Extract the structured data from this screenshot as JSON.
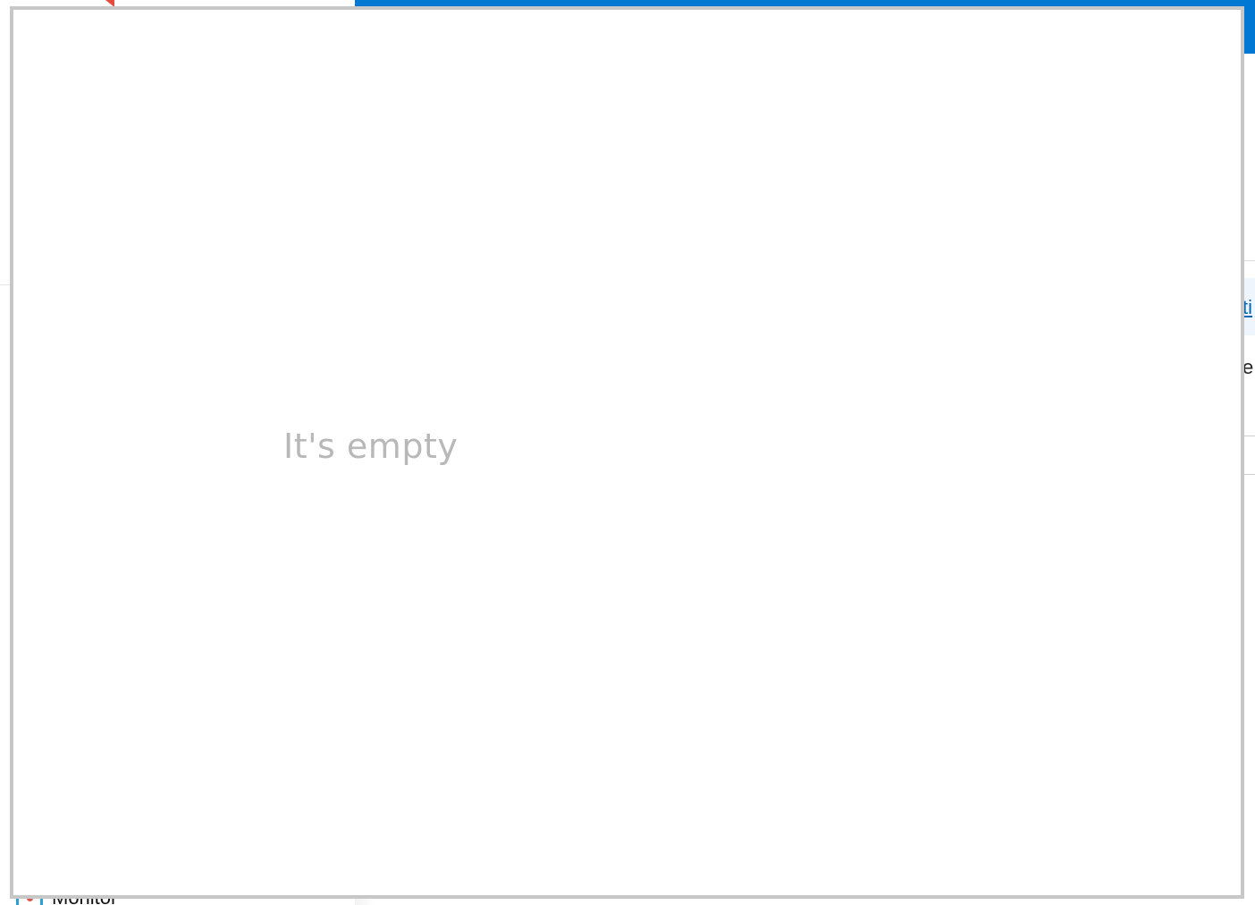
{
  "background": {
    "sidebar": {
      "items": [
        {
          "label": "Monitor",
          "icon": "monitor-icon"
        }
      ]
    },
    "right_partial": {
      "link_fragment": "ti",
      "text_fragment": "e"
    },
    "colors": {
      "topbar": "#0078d4",
      "link": "#0067b8"
    }
  },
  "panel": {
    "empty_message": "It's empty",
    "border_color": "#c7c7c7",
    "message_color": "#b8b8b8"
  }
}
